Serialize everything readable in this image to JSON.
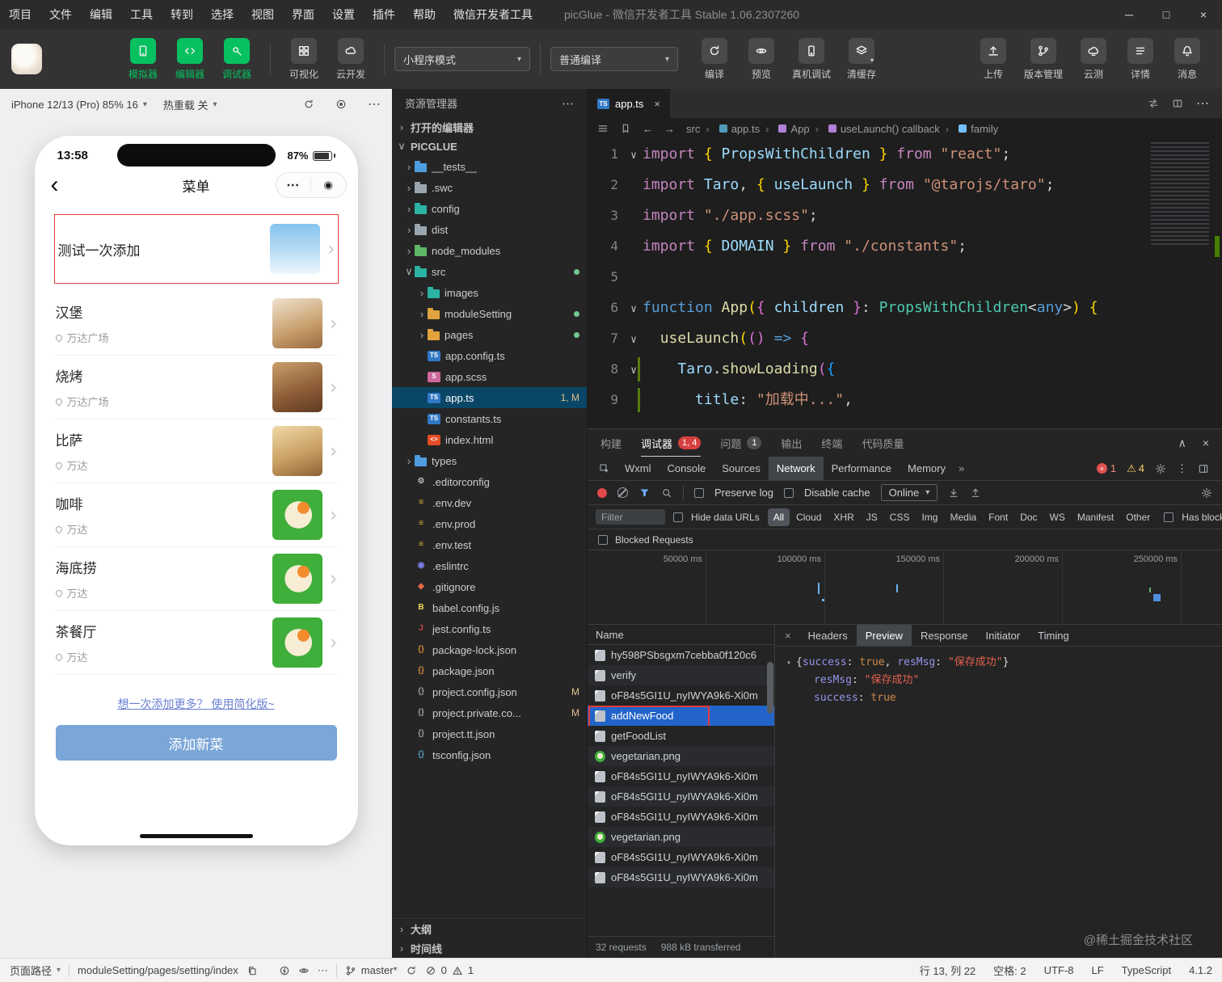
{
  "icons": {
    "more": "⋯",
    "close": "×",
    "caret": "▾",
    "chev_r": "›",
    "chev_d": "∨",
    "back": "‹",
    "collapse": "∧",
    "dots_v": "⋮",
    "arrow_l": "←",
    "arrow_r": "→",
    "minimize": "─",
    "maximize": "□",
    "target": "◉",
    "guillemet": "»",
    "fold": "∨",
    "warn": "⚠",
    "err_x": "×",
    "pv_arrow": "▾"
  },
  "menubar": {
    "items": [
      "项目",
      "文件",
      "编辑",
      "工具",
      "转到",
      "选择",
      "视图",
      "界面",
      "设置",
      "插件",
      "帮助",
      "微信开发者工具"
    ],
    "title": "picGlue - 微信开发者工具 Stable 1.06.2307260"
  },
  "toolbar": {
    "main_tools": [
      {
        "label": "模拟器",
        "active": true
      },
      {
        "label": "编辑器",
        "active": true
      },
      {
        "label": "调试器",
        "active": true
      },
      {
        "label": "可视化",
        "active": false
      },
      {
        "label": "云开发",
        "active": false
      }
    ],
    "mode_select": "小程序模式",
    "compile_select": "普通编译",
    "action_tools": [
      {
        "label": "编译"
      },
      {
        "label": "预览"
      },
      {
        "label": "真机调试"
      },
      {
        "label": "清缓存"
      }
    ],
    "right_tools": [
      {
        "label": "上传"
      },
      {
        "label": "版本管理"
      },
      {
        "label": "云测"
      },
      {
        "label": "详情"
      },
      {
        "label": "消息"
      }
    ]
  },
  "simulator": {
    "device_select": "iPhone 12/13 (Pro) 85% 16",
    "hot_reload": "热重载 关",
    "phone": {
      "time": "13:58",
      "battery": "87%",
      "nav_title": "菜单",
      "food_items": [
        {
          "name": "测试一次添加",
          "location": "",
          "img": "img-sky",
          "highlight": true
        },
        {
          "name": "汉堡",
          "location": "万达广场",
          "img": "img-drink"
        },
        {
          "name": "烧烤",
          "location": "万达广场",
          "img": "img-bbq"
        },
        {
          "name": "比萨",
          "location": "万达",
          "img": "img-pizza"
        },
        {
          "name": "咖啡",
          "location": "万达",
          "img": "img-veg"
        },
        {
          "name": "海底捞",
          "location": "万达",
          "img": "img-veg"
        },
        {
          "name": "茶餐厅",
          "location": "万达",
          "img": "img-veg"
        }
      ],
      "more_link": "想一次添加更多？ 使用简化版~",
      "add_button": "添加新菜"
    }
  },
  "explorer": {
    "title": "资源管理器",
    "open_editors": "打开的编辑器",
    "project": "PICGLUE",
    "tree": [
      {
        "name": "__tests__",
        "pad": 14,
        "chev": "›",
        "fcolor": "#4d9de0"
      },
      {
        "name": ".swc",
        "pad": 14,
        "chev": "›",
        "fcolor": "#9aa7b0"
      },
      {
        "name": "config",
        "pad": 14,
        "chev": "›",
        "fcolor": "#2bb3a3"
      },
      {
        "name": "dist",
        "pad": 14,
        "chev": "›",
        "fcolor": "#9aa7b0"
      },
      {
        "name": "node_modules",
        "pad": 14,
        "chev": "›",
        "fcolor": "#5fb865"
      },
      {
        "name": "src",
        "pad": 14,
        "chev": "∨",
        "fcolor": "#2bb3a3",
        "dot": true
      },
      {
        "name": "images",
        "pad": 30,
        "chev": "›",
        "fcolor": "#2bb3a3"
      },
      {
        "name": "moduleSetting",
        "pad": 30,
        "chev": "›",
        "fcolor": "#e2a33e",
        "dot": true
      },
      {
        "name": "pages",
        "pad": 30,
        "chev": "›",
        "fcolor": "#e2a33e",
        "dot": true
      },
      {
        "name": "app.config.ts",
        "pad": 30,
        "chev": "",
        "icon": "TS",
        "icon_bg": "#3178c6",
        "icon_color": "#ffffff"
      },
      {
        "name": "app.scss",
        "pad": 30,
        "chev": "",
        "icon": "S",
        "icon_bg": "#cd6799",
        "icon_color": "#ffffff"
      },
      {
        "name": "app.ts",
        "pad": 30,
        "chev": "",
        "icon": "TS",
        "icon_bg": "#3178c6",
        "icon_color": "#ffffff",
        "selected": true,
        "badge": "1, M"
      },
      {
        "name": "constants.ts",
        "pad": 30,
        "chev": "",
        "icon": "TS",
        "icon_bg": "#3178c6",
        "icon_color": "#ffffff"
      },
      {
        "name": "index.html",
        "pad": 30,
        "chev": "",
        "icon": "<>",
        "icon_bg": "#e44d26",
        "icon_color": "#ffffff"
      },
      {
        "name": "types",
        "pad": 14,
        "chev": "›",
        "fcolor": "#4d9de0"
      },
      {
        "name": ".editorconfig",
        "pad": 14,
        "chev": "",
        "icon": "⚙",
        "icon_color": "#b5b5b5"
      },
      {
        "name": ".env.dev",
        "pad": 14,
        "chev": "",
        "icon": "≡",
        "icon_color": "#ddb62b"
      },
      {
        "name": ".env.prod",
        "pad": 14,
        "chev": "",
        "icon": "≡",
        "icon_color": "#ddb62b"
      },
      {
        "name": ".env.test",
        "pad": 14,
        "chev": "",
        "icon": "≡",
        "icon_color": "#ddb62b"
      },
      {
        "name": ".eslintrc",
        "pad": 14,
        "chev": "",
        "icon": "◉",
        "icon_color": "#8080f2"
      },
      {
        "name": ".gitignore",
        "pad": 14,
        "chev": "",
        "icon": "◆",
        "icon_color": "#e8684a"
      },
      {
        "name": "babel.config.js",
        "pad": 14,
        "chev": "",
        "icon": "B",
        "icon_color": "#f5da55"
      },
      {
        "name": "jest.config.ts",
        "pad": 14,
        "chev": "",
        "icon": "J",
        "icon_color": "#d04545"
      },
      {
        "name": "package-lock.json",
        "pad": 14,
        "chev": "",
        "icon": "{}",
        "icon_color": "#cb8837"
      },
      {
        "name": "package.json",
        "pad": 14,
        "chev": "",
        "icon": "{}",
        "icon_color": "#cb8837"
      },
      {
        "name": "project.config.json",
        "pad": 14,
        "chev": "",
        "icon": "{}",
        "icon_color": "#9b9b9b",
        "badge": "M"
      },
      {
        "name": "project.private.co...",
        "pad": 14,
        "chev": "",
        "icon": "{}",
        "icon_color": "#9b9b9b",
        "badge": "M"
      },
      {
        "name": "project.tt.json",
        "pad": 14,
        "chev": "",
        "icon": "{}",
        "icon_color": "#9b9b9b"
      },
      {
        "name": "tsconfig.json",
        "pad": 14,
        "chev": "",
        "icon": "{}",
        "icon_color": "#519aba"
      }
    ],
    "bottom_sections": [
      {
        "label": "大纲"
      },
      {
        "label": "时间线"
      }
    ]
  },
  "editor": {
    "tab": "app.ts",
    "tab_icon": "TS",
    "breadcrumbs": [
      {
        "label": "src"
      },
      {
        "label": "app.ts",
        "icon_color": "#519aba"
      },
      {
        "label": "App",
        "icon_color": "#b180d7"
      },
      {
        "label": "useLaunch() callback",
        "icon_color": "#b180d7"
      },
      {
        "label": "family",
        "icon_color": "#75beff"
      }
    ],
    "code_lines": [
      {
        "num": "1",
        "fold": true,
        "tokens": [
          {
            "t": "import ",
            "c": "kw"
          },
          {
            "t": "{ ",
            "c": "br1"
          },
          {
            "t": "PropsWithChildren",
            "c": "var"
          },
          {
            "t": " } ",
            "c": "br1"
          },
          {
            "t": "from ",
            "c": "kw"
          },
          {
            "t": "\"react\"",
            "c": "str"
          },
          {
            "t": ";",
            "c": "pl"
          }
        ]
      },
      {
        "num": "2",
        "tokens": [
          {
            "t": "import ",
            "c": "kw"
          },
          {
            "t": "Taro",
            "c": "var"
          },
          {
            "t": ", ",
            "c": "pl"
          },
          {
            "t": "{ ",
            "c": "br1"
          },
          {
            "t": "useLaunch",
            "c": "var"
          },
          {
            "t": " } ",
            "c": "br1"
          },
          {
            "t": "from ",
            "c": "kw"
          },
          {
            "t": "\"@tarojs/taro\"",
            "c": "str"
          },
          {
            "t": ";",
            "c": "pl"
          }
        ]
      },
      {
        "num": "3",
        "tokens": [
          {
            "t": "import ",
            "c": "kw"
          },
          {
            "t": "\"./app.scss\"",
            "c": "str"
          },
          {
            "t": ";",
            "c": "pl"
          }
        ]
      },
      {
        "num": "4",
        "tokens": [
          {
            "t": "import ",
            "c": "kw"
          },
          {
            "t": "{ ",
            "c": "br1"
          },
          {
            "t": "DOMAIN",
            "c": "var"
          },
          {
            "t": " } ",
            "c": "br1"
          },
          {
            "t": "from ",
            "c": "kw"
          },
          {
            "t": "\"./constants\"",
            "c": "str"
          },
          {
            "t": ";",
            "c": "pl"
          }
        ]
      },
      {
        "num": "5",
        "tokens": []
      },
      {
        "num": "6",
        "fold": true,
        "tokens": [
          {
            "t": "function ",
            "c": "kw2"
          },
          {
            "t": "App",
            "c": "fn"
          },
          {
            "t": "(",
            "c": "br1"
          },
          {
            "t": "{ ",
            "c": "br2"
          },
          {
            "t": "children",
            "c": "var"
          },
          {
            "t": " }",
            "c": "br2"
          },
          {
            "t": ": ",
            "c": "pl"
          },
          {
            "t": "PropsWithChildren",
            "c": "ty"
          },
          {
            "t": "<",
            "c": "pl"
          },
          {
            "t": "any",
            "c": "kw2"
          },
          {
            "t": ">",
            "c": "pl"
          },
          {
            "t": ")",
            "c": "br1"
          },
          {
            "t": " {",
            "c": "br1"
          }
        ]
      },
      {
        "num": "7",
        "fold": true,
        "tokens": [
          {
            "t": "  ",
            "c": "pl"
          },
          {
            "t": "useLaunch",
            "c": "fn"
          },
          {
            "t": "(",
            "c": "br1"
          },
          {
            "t": "()",
            "c": "br2"
          },
          {
            "t": " ",
            "c": "pl"
          },
          {
            "t": "=>",
            "c": "kw2"
          },
          {
            "t": " ",
            "c": "pl"
          },
          {
            "t": "{",
            "c": "br2"
          }
        ]
      },
      {
        "num": "8",
        "fold": true,
        "added": true,
        "tokens": [
          {
            "t": "    ",
            "c": "pl"
          },
          {
            "t": "Taro",
            "c": "var"
          },
          {
            "t": ".",
            "c": "pl"
          },
          {
            "t": "showLoading",
            "c": "fn"
          },
          {
            "t": "(",
            "c": "br2"
          },
          {
            "t": "{",
            "c": "br3"
          }
        ]
      },
      {
        "num": "9",
        "added": true,
        "tokens": [
          {
            "t": "      ",
            "c": "pl"
          },
          {
            "t": "title",
            "c": "var"
          },
          {
            "t": ": ",
            "c": "pl"
          },
          {
            "t": "\"加载中...\"",
            "c": "str"
          },
          {
            "t": ",",
            "c": "pl"
          }
        ]
      }
    ]
  },
  "debug": {
    "panel_tabs": [
      {
        "label": "构建"
      },
      {
        "label": "调试器",
        "active": true,
        "badge": "1, 4",
        "badge_bg": "#d64040"
      },
      {
        "label": "问题",
        "badge": "1",
        "badge_bg": "#4f4f4f"
      },
      {
        "label": "输出"
      },
      {
        "label": "终端"
      },
      {
        "label": "代码质量"
      }
    ],
    "devtools_tabs": [
      {
        "label": "Wxml"
      },
      {
        "label": "Console"
      },
      {
        "label": "Sources"
      },
      {
        "label": "Network",
        "active": true
      },
      {
        "label": "Performance"
      },
      {
        "label": "Memory"
      }
    ],
    "error_count": "1",
    "warning_count": "4"
  },
  "network": {
    "preserve_log": "Preserve log",
    "disable_cache": "Disable cache",
    "throttle": "Online",
    "filter_placeholder": "Filter",
    "hide_data_urls": "Hide data URLs",
    "filter_pills": [
      {
        "label": "All",
        "active": true
      },
      {
        "label": "Cloud"
      },
      {
        "label": "XHR"
      },
      {
        "label": "JS"
      },
      {
        "label": "CSS"
      },
      {
        "label": "Img"
      },
      {
        "label": "Media"
      },
      {
        "label": "Font"
      },
      {
        "label": "Doc"
      },
      {
        "label": "WS"
      },
      {
        "label": "Manifest"
      },
      {
        "label": "Other"
      }
    ],
    "has_blocked_cookies": "Has blocked cookies",
    "blocked_requests": "Blocked Requests",
    "timeline_labels": [
      {
        "label": "50000 ms"
      },
      {
        "label": "100000 ms"
      },
      {
        "label": "150000 ms"
      },
      {
        "label": "200000 ms"
      },
      {
        "label": "250000 ms"
      }
    ],
    "name_header": "Name",
    "requests": [
      {
        "name": "hy598PSbsgxm7cebba0f120c6",
        "icon": "nic-doc"
      },
      {
        "name": "verify",
        "icon": "nic-doc"
      },
      {
        "name": "oF84s5GI1U_nyIWYA9k6-Xi0m",
        "icon": "nic-doc"
      },
      {
        "name": "addNewFood",
        "icon": "nic-doc",
        "selected": true,
        "redbox": true
      },
      {
        "name": "getFoodList",
        "icon": "nic-doc"
      },
      {
        "name": "vegetarian.png",
        "icon": "nic-img"
      },
      {
        "name": "oF84s5GI1U_nyIWYA9k6-Xi0m",
        "icon": "nic-doc"
      },
      {
        "name": "oF84s5GI1U_nyIWYA9k6-Xi0m",
        "icon": "nic-doc"
      },
      {
        "name": "oF84s5GI1U_nyIWYA9k6-Xi0m",
        "icon": "nic-doc"
      },
      {
        "name": "vegetarian.png",
        "icon": "nic-img"
      },
      {
        "name": "oF84s5GI1U_nyIWYA9k6-Xi0m",
        "icon": "nic-doc"
      },
      {
        "name": "oF84s5GI1U_nyIWYA9k6-Xi0m",
        "icon": "nic-doc"
      }
    ],
    "summary_requests": "32 requests",
    "summary_transferred": "988 kB transferred",
    "detail_tabs": [
      {
        "label": "Headers"
      },
      {
        "label": "Preview",
        "active": true
      },
      {
        "label": "Response"
      },
      {
        "label": "Initiator"
      },
      {
        "label": "Timing"
      }
    ],
    "preview_lines": [
      {
        "tokens": [
          {
            "t": "▾ ",
            "c": "arr"
          },
          {
            "t": "{",
            "c": "jpl"
          },
          {
            "t": "success",
            "c": "key"
          },
          {
            "t": ": ",
            "c": "jpl"
          },
          {
            "t": "true",
            "c": "bool"
          },
          {
            "t": ", ",
            "c": "jpl"
          },
          {
            "t": "resMsg",
            "c": "key"
          },
          {
            "t": ": ",
            "c": "jpl"
          },
          {
            "t": "\"保存成功\"",
            "c": "jstr"
          },
          {
            "t": "}",
            "c": "jpl"
          }
        ]
      },
      {
        "cls": "ind",
        "tokens": [
          {
            "t": "resMsg",
            "c": "key"
          },
          {
            "t": ": ",
            "c": "jpl"
          },
          {
            "t": "\"保存成功\"",
            "c": "jstr"
          }
        ]
      },
      {
        "cls": "ind",
        "tokens": [
          {
            "t": "success",
            "c": "key"
          },
          {
            "t": ": ",
            "c": "jpl"
          },
          {
            "t": "true",
            "c": "bool"
          }
        ]
      }
    ]
  },
  "statusbar": {
    "page_path_label": "页面路径",
    "page_path": "moduleSetting/pages/setting/index",
    "branch": "master*",
    "errors": "0",
    "warnings": "1",
    "line_col": "行 13, 列 22",
    "spaces": "空格: 2",
    "encoding": "UTF-8",
    "eol": "LF",
    "language": "TypeScript",
    "version": "4.1.2"
  },
  "watermark": "@稀土掘金技术社区"
}
